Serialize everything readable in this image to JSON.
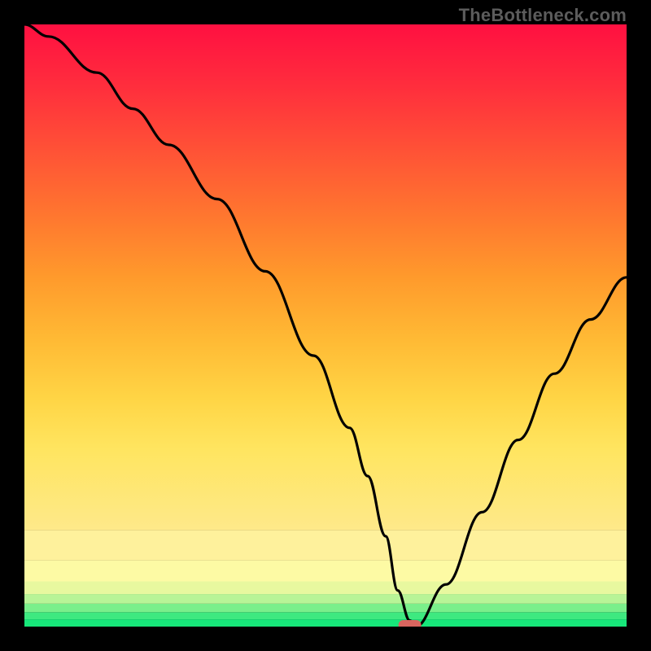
{
  "watermark": "TheBottleneck.com",
  "chart_data": {
    "type": "line",
    "title": "",
    "xlabel": "",
    "ylabel": "",
    "xlim": [
      0,
      100
    ],
    "ylim": [
      0,
      100
    ],
    "x": [
      0,
      4,
      12,
      18,
      24,
      32,
      40,
      48,
      54,
      57,
      60,
      62,
      64,
      65,
      70,
      76,
      82,
      88,
      94,
      100
    ],
    "values": [
      100,
      98,
      92,
      86,
      80,
      71,
      59,
      45,
      33,
      25,
      15,
      6,
      1,
      0,
      7,
      19,
      31,
      42,
      51,
      58
    ],
    "marker": {
      "x": 64,
      "y": 0
    },
    "bands": [
      {
        "y0": 0.0,
        "y1": 1.2,
        "color": "#17e77a"
      },
      {
        "y0": 1.2,
        "y1": 2.4,
        "color": "#3ee980"
      },
      {
        "y0": 2.4,
        "y1": 3.8,
        "color": "#7aef8b"
      },
      {
        "y0": 3.8,
        "y1": 5.4,
        "color": "#b8f497"
      },
      {
        "y0": 5.4,
        "y1": 7.5,
        "color": "#e8f89f"
      },
      {
        "y0": 7.5,
        "y1": 11,
        "color": "#fdfaa4"
      },
      {
        "y0": 11,
        "y1": 16,
        "color": "#fef19c"
      },
      {
        "y0": 16,
        "y1": 100,
        "gradient": true
      }
    ],
    "gradient_stops": [
      {
        "offset": 0,
        "color": "#ff1041"
      },
      {
        "offset": 12,
        "color": "#ff2d3d"
      },
      {
        "offset": 25,
        "color": "#ff5236"
      },
      {
        "offset": 38,
        "color": "#ff772f"
      },
      {
        "offset": 50,
        "color": "#ff9a2c"
      },
      {
        "offset": 62,
        "color": "#ffb934"
      },
      {
        "offset": 74,
        "color": "#ffd545"
      },
      {
        "offset": 84,
        "color": "#ffe560"
      },
      {
        "offset": 100,
        "color": "#fee98a"
      }
    ]
  }
}
